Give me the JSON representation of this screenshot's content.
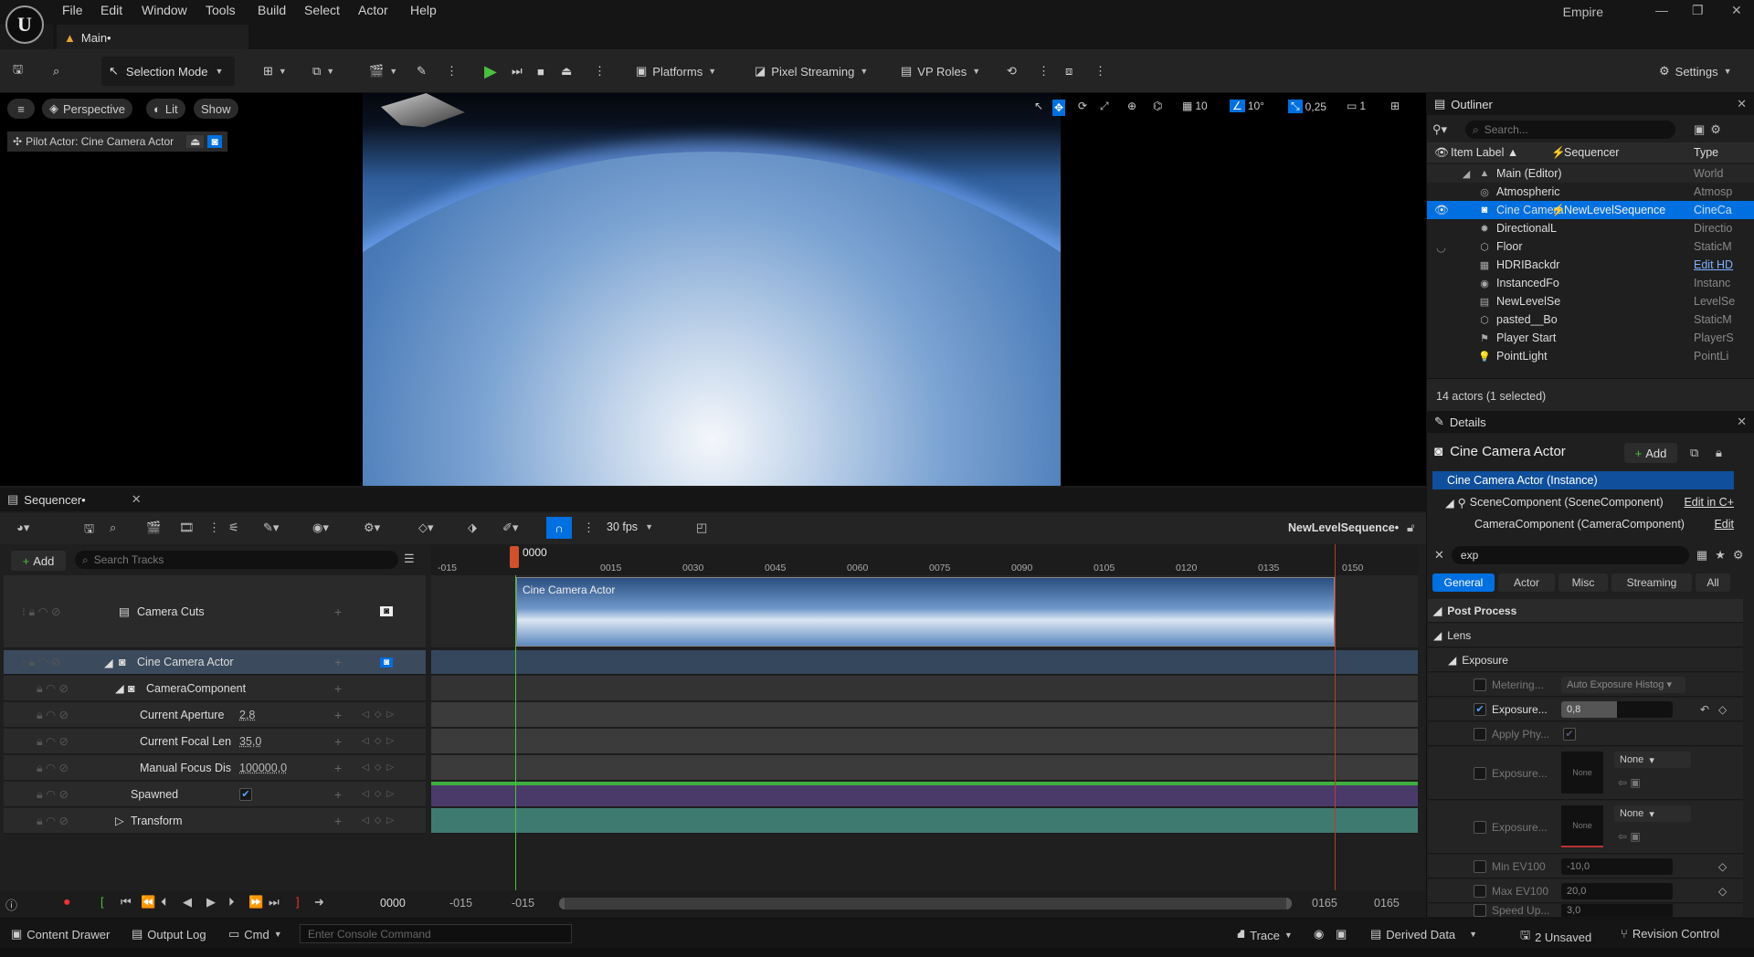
{
  "menu": {
    "items": [
      "File",
      "Edit",
      "Window",
      "Tools",
      "Build",
      "Select",
      "Actor",
      "Help"
    ],
    "project": "Empire"
  },
  "tab": {
    "title": "Main•"
  },
  "toolbar": {
    "selection_mode": "Selection Mode",
    "platforms": "Platforms",
    "pixel_streaming": "Pixel Streaming",
    "vp_roles": "VP Roles",
    "settings": "Settings"
  },
  "viewport": {
    "perspective": "Perspective",
    "lit": "Lit",
    "show": "Show",
    "pilot": "Pilot Actor: Cine Camera Actor",
    "grid": "10",
    "angle": "10°",
    "scale": "0,25",
    "camera_speed": "1"
  },
  "outliner": {
    "title": "Outliner",
    "search_placeholder": "Search...",
    "col_label": "Item Label ▲",
    "col_sequencer": "Sequencer",
    "col_type": "Type",
    "rows": [
      {
        "label": "Main (Editor)",
        "seq": "",
        "type": "World"
      },
      {
        "label": "Atmospheric",
        "seq": "",
        "type": "Atmosp"
      },
      {
        "label": "Cine Camera",
        "seq": "NewLevelSequence",
        "type": "CineCa"
      },
      {
        "label": "DirectionalL",
        "seq": "",
        "type": "Directio"
      },
      {
        "label": "Floor",
        "seq": "",
        "type": "StaticM"
      },
      {
        "label": "HDRIBackdr",
        "seq": "",
        "type": "Edit HD"
      },
      {
        "label": "InstancedFo",
        "seq": "",
        "type": "Instanc"
      },
      {
        "label": "NewLevelSe",
        "seq": "",
        "type": "LevelSe"
      },
      {
        "label": "pasted__Bo",
        "seq": "",
        "type": "StaticM"
      },
      {
        "label": "Player Start",
        "seq": "",
        "type": "PlayerS"
      },
      {
        "label": "PointLight",
        "seq": "",
        "type": "PointLi"
      }
    ],
    "footer": "14 actors (1 selected)"
  },
  "details": {
    "title": "Details",
    "actor": "Cine Camera Actor",
    "add": "Add",
    "instance": "Cine Camera Actor (Instance)",
    "scene": "SceneComponent (SceneComponent)",
    "scene_edit": "Edit in C+",
    "camera": "CameraComponent (CameraComponent)",
    "camera_edit": "Edit",
    "search": "exp",
    "tabs": [
      "General",
      "Actor",
      "Misc",
      "Streaming",
      "All"
    ],
    "sections": {
      "post_process": "Post Process",
      "lens": "Lens",
      "exposure": "Exposure"
    },
    "props": [
      {
        "name": "Metering...",
        "value": "Auto Exposure Histog"
      },
      {
        "name": "Exposure...",
        "value": "0,8"
      },
      {
        "name": "Apply Phy...",
        "value": ""
      },
      {
        "name": "Exposure...",
        "value": "None"
      },
      {
        "name": "Exposure...",
        "value": "None"
      },
      {
        "name": "Min EV100",
        "value": "-10,0"
      },
      {
        "name": "Max EV100",
        "value": "20,0"
      },
      {
        "name": "Speed Up...",
        "value": "3,0"
      }
    ],
    "thumb_label": "None"
  },
  "sequencer": {
    "title": "Sequencer•",
    "fps": "30 fps",
    "sequence_name": "NewLevelSequence•",
    "add": "Add",
    "search_placeholder": "Search Tracks",
    "current_frame": "0000",
    "ticks": [
      "-015",
      "0015",
      "0030",
      "0045",
      "0060",
      "0075",
      "0090",
      "0105",
      "0120",
      "0135",
      "0150"
    ],
    "tracks": [
      {
        "name": "Camera Cuts",
        "value": ""
      },
      {
        "name": "Cine Camera Actor",
        "value": ""
      },
      {
        "name": "CameraComponent",
        "value": ""
      },
      {
        "name": "Current Aperture",
        "value": "2,8"
      },
      {
        "name": "Current Focal Len",
        "value": "35,0"
      },
      {
        "name": "Manual Focus Dis",
        "value": "100000,0"
      },
      {
        "name": "Spawned",
        "value": ""
      },
      {
        "name": "Transform",
        "value": ""
      }
    ],
    "clip_label": "Cine Camera Actor",
    "range": {
      "start": "-015",
      "start2": "-015",
      "end": "0165",
      "end2": "0165",
      "frame": "0000"
    }
  },
  "statusbar": {
    "content_drawer": "Content Drawer",
    "output_log": "Output Log",
    "cmd": "Cmd",
    "console_placeholder": "Enter Console Command",
    "trace": "Trace",
    "derived_data": "Derived Data",
    "unsaved": "2 Unsaved",
    "revision_control": "Revision Control"
  }
}
